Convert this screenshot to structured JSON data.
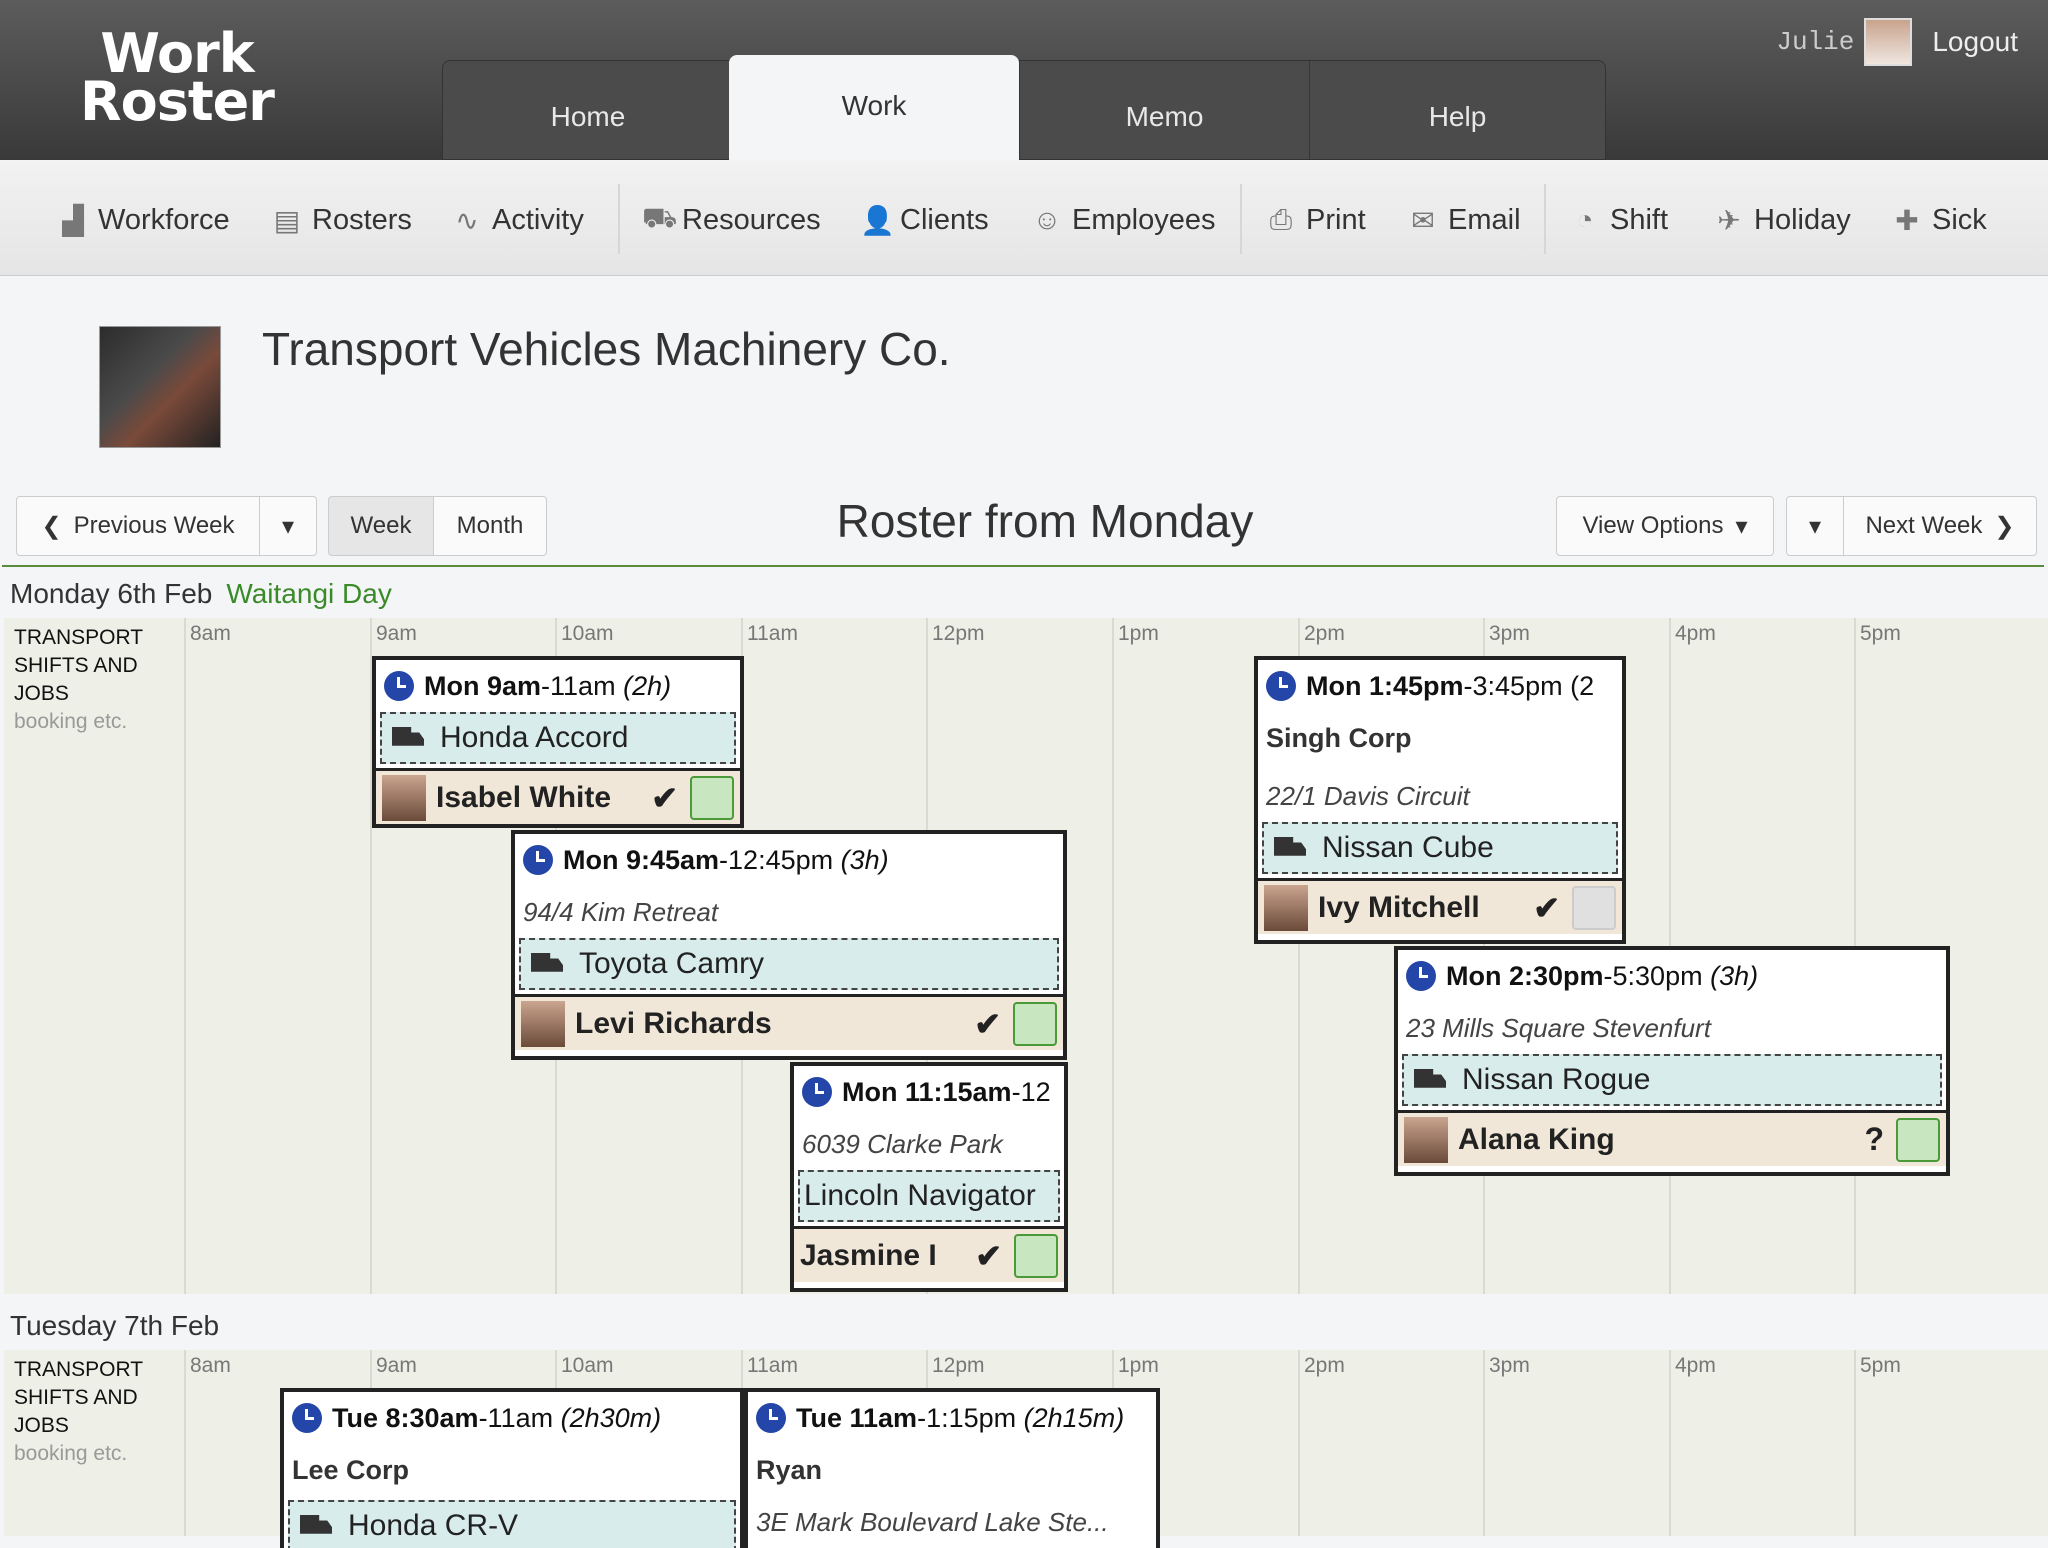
{
  "header": {
    "logo_line1": "Work",
    "logo_line2": "Roster",
    "tabs": [
      "Home",
      "Work",
      "Memo",
      "Help"
    ],
    "user_name": "Julie",
    "logout": "Logout"
  },
  "toolbar": {
    "items": [
      {
        "icon": "factory-icon",
        "glyph": "▟",
        "label": "Workforce"
      },
      {
        "icon": "clipboard-icon",
        "glyph": "▤",
        "label": "Rosters"
      },
      {
        "icon": "activity-icon",
        "glyph": "∿",
        "label": "Activity"
      },
      {
        "icon": "truck-icon",
        "glyph": "⛟",
        "label": "Resources"
      },
      {
        "icon": "clients-icon",
        "glyph": "👤",
        "label": "Clients"
      },
      {
        "icon": "employees-icon",
        "glyph": "☺",
        "label": "Employees"
      },
      {
        "icon": "print-icon",
        "glyph": "⎙",
        "label": "Print"
      },
      {
        "icon": "email-icon",
        "glyph": "✉",
        "label": "Email"
      },
      {
        "icon": "clock-icon",
        "glyph": "◔",
        "label": "Shift"
      },
      {
        "icon": "plane-icon",
        "glyph": "✈",
        "label": "Holiday"
      },
      {
        "icon": "medical-icon",
        "glyph": "✚",
        "label": "Sick"
      }
    ]
  },
  "company": {
    "name": "Transport Vehicles Machinery Co."
  },
  "nav": {
    "prev": "Previous Week",
    "week": "Week",
    "month": "Month",
    "title": "Roster from Monday",
    "view_options": "View Options",
    "next": "Next Week"
  },
  "grid": {
    "label_line1": "TRANSPORT",
    "label_line2": "SHIFTS AND",
    "label_line3": "JOBS",
    "label_sub": "booking etc.",
    "hours": [
      "8am",
      "9am",
      "10am",
      "11am",
      "12pm",
      "1pm",
      "2pm",
      "3pm",
      "4pm",
      "5pm"
    ]
  },
  "days": [
    {
      "title": "Monday 6th Feb",
      "holiday": "Waitangi Day",
      "shifts": [
        {
          "start": "Mon 9am",
          "end": "-11am",
          "dur": "(2h)",
          "client": "",
          "address": "",
          "vehicle": "Honda Accord",
          "employee": "Isabel White",
          "mark": "✔",
          "box": "green"
        },
        {
          "start": "Mon 9:45am",
          "end": "-12:45pm",
          "dur": "(3h)",
          "client": "",
          "address": "94/4 Kim Retreat",
          "vehicle": "Toyota Camry",
          "employee": "Levi Richards",
          "mark": "✔",
          "box": "green"
        },
        {
          "start": "Mon 11:15am",
          "end": "-12",
          "dur": "",
          "client": "",
          "address": "6039 Clarke Park",
          "vehicle": "Lincoln Navigator",
          "employee": "Jasmine I",
          "mark": "✔",
          "box": "green"
        },
        {
          "start": "Mon 1:45pm",
          "end": "-3:45pm",
          "dur": "(2",
          "client": "Singh Corp",
          "address": "22/1 Davis Circuit",
          "vehicle": "Nissan Cube",
          "employee": "Ivy Mitchell",
          "mark": "✔",
          "box": "grey"
        },
        {
          "start": "Mon 2:30pm",
          "end": "-5:30pm",
          "dur": "(3h)",
          "client": "",
          "address": "23 Mills Square Stevenfurt",
          "vehicle": "Nissan Rogue",
          "employee": "Alana King",
          "mark": "?",
          "box": "green"
        }
      ]
    },
    {
      "title": "Tuesday 7th Feb",
      "holiday": "",
      "shifts": [
        {
          "start": "Tue 8:30am",
          "end": "-11am",
          "dur": "(2h30m)",
          "client": "Lee Corp",
          "address": "",
          "vehicle": "Honda CR-V",
          "employee": "",
          "mark": "",
          "box": ""
        },
        {
          "start": "Tue 11am",
          "end": "-1:15pm",
          "dur": "(2h15m)",
          "client": "Ryan",
          "address": "3E Mark Boulevard Lake Ste...",
          "vehicle": "",
          "employee": "",
          "mark": "",
          "box": ""
        }
      ]
    }
  ]
}
